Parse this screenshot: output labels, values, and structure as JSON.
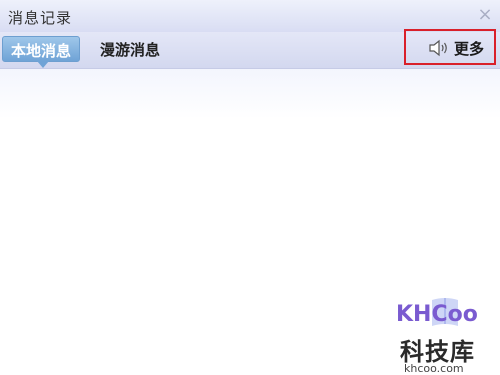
{
  "window": {
    "title": "消息记录",
    "close_glyph": "×"
  },
  "tabs": [
    {
      "label": "本地消息",
      "active": true
    },
    {
      "label": "漫游消息",
      "active": false
    }
  ],
  "more": {
    "label": "更多",
    "icon": "speaker-icon"
  },
  "watermark": {
    "logo_text": "KHCoo",
    "chinese": "科技库",
    "url": "khcoo.com"
  },
  "colors": {
    "active_tab": "#6fa3d6",
    "highlight_border": "#d9202a",
    "titlebar": "#dfe2f5"
  }
}
